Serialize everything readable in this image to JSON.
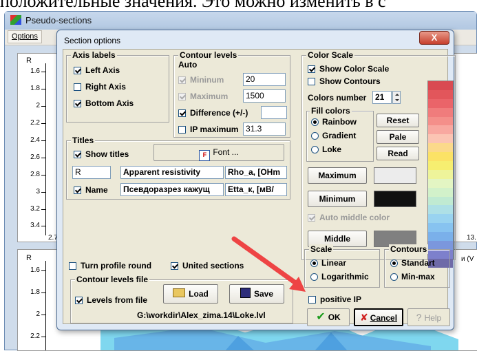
{
  "top_text": "положительные значения. Это можно изменить в с",
  "app": {
    "title": "Pseudo-sections",
    "menu_options": "Options"
  },
  "plot_top": {
    "axis_letter": "R",
    "yticks": [
      "1.6",
      "1.8",
      "2",
      "2.2",
      "2.4",
      "2.6",
      "2.8",
      "3",
      "3.2",
      "3.4"
    ],
    "x_left": "2.7",
    "x_right": "13."
  },
  "plot_bottom": {
    "axis_letter": "R",
    "yticks": [
      "1.6",
      "1.8",
      "2",
      "2.2"
    ],
    "right_hint": "и (V"
  },
  "dialog": {
    "title": "Section options",
    "close_label": "X",
    "axis_labels": {
      "title": "Axis labels",
      "left": "Left Axis",
      "left_checked": true,
      "right": "Right Axis",
      "right_checked": false,
      "bottom": "Bottom Axis",
      "bottom_checked": true
    },
    "contour_levels": {
      "title": "Contour levels",
      "auto": "Auto",
      "minimum_label": "Mininum",
      "minimum_value": "20",
      "maximum_label": "Maximum",
      "maximum_value": "1500",
      "difference_label": "Difference (+/-)",
      "difference_value": "",
      "ip_max_label": "IP maximum",
      "ip_max_value": "31.3"
    },
    "titles": {
      "title": "Titles",
      "show_titles": "Show titles",
      "font_button": "Font ...",
      "r1_c1": "R",
      "r1_c2": "Apparent resistivity",
      "r1_c3": "Rho_a, [OHm",
      "name_label": "Name",
      "r2_c2": "Псевдоразрез кажущ",
      "r2_c3": "Etta_к, [мВ/"
    },
    "turn_profile_round": "Turn profile round",
    "united_sections": "United sections",
    "contour_file": {
      "title": "Contour levels file",
      "levels_from_file": "Levels from file",
      "load": "Load",
      "save": "Save",
      "path": "G:\\workdir\\Alex_zima.14\\Loke.lvl"
    },
    "color_scale": {
      "title": "Color Scale",
      "show_color_scale": "Show Color Scale",
      "show_contours": "Show Contours",
      "colors_number_label": "Colors number",
      "colors_number_value": "21",
      "fill_colors_title": "Fill colors",
      "fill_rainbow": "Rainbow",
      "fill_gradient": "Gradient",
      "fill_loke": "Loke",
      "reset": "Reset",
      "pale": "Pale",
      "read": "Read",
      "maximum": "Maximum",
      "minimum": "Minimum",
      "auto_middle_color": "Auto middle color",
      "middle": "Middle",
      "palette_colors": [
        "#d94a52",
        "#e2565b",
        "#ea6469",
        "#f07c7c",
        "#f48f8a",
        "#f8a8a0",
        "#fbc4b3",
        "#fbd98b",
        "#fbe266",
        "#f6ee70",
        "#eef49a",
        "#e3f5c3",
        "#d2f1ca",
        "#c0ead2",
        "#aee0e6",
        "#99d3f0",
        "#87c3f0",
        "#7ab0ea",
        "#7b97dd",
        "#7d80cc",
        "#6e6aa8"
      ]
    },
    "scale": {
      "title": "Scale",
      "linear": "Linear",
      "logarithmic": "Logarithmic"
    },
    "contours": {
      "title": "Contours",
      "standart": "Standart",
      "min_max": "Min-max"
    },
    "positive_ip": "positive IP",
    "ok": "OK",
    "cancel": "Cancel",
    "help": "Help"
  }
}
